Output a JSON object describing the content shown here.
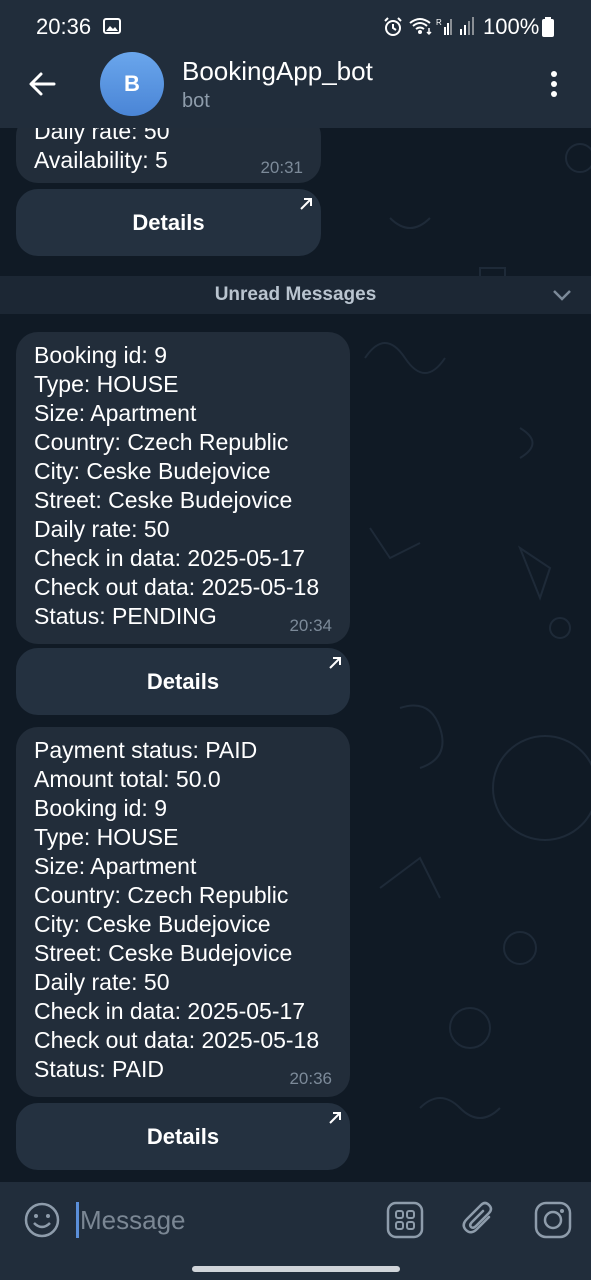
{
  "status_bar": {
    "time": "20:36",
    "battery": "100%"
  },
  "header": {
    "avatar_letter": "B",
    "title": "BookingApp_bot",
    "subtitle": "bot"
  },
  "messages": [
    {
      "lines": [
        "Daily rate: 50",
        "Availability: 5"
      ],
      "time": "20:31",
      "button": "Details"
    },
    {
      "lines": [
        "Booking id: 9",
        "Type: HOUSE",
        "Size: Apartment",
        "Country: Czech Republic",
        "City: Ceske Budejovice",
        "Street: Ceske Budejovice",
        "Daily rate: 50",
        "Check in data: 2025-05-17",
        "Check out data: 2025-05-18",
        "Status: PENDING"
      ],
      "time": "20:34",
      "button": "Details"
    },
    {
      "lines": [
        "Payment status: PAID",
        "Amount total: 50.0",
        "Booking id: 9",
        "Type: HOUSE",
        "Size: Apartment",
        "Country: Czech Republic",
        "City: Ceske Budejovice",
        "Street: Ceske Budejovice",
        "Daily rate: 50",
        "Check in data: 2025-05-17",
        "Check out data: 2025-05-18",
        "Status: PAID"
      ],
      "time": "20:36",
      "button": "Details"
    }
  ],
  "unread_label": "Unread Messages",
  "input": {
    "placeholder": "Message"
  },
  "colors": {
    "bubble": "#222d3a",
    "header": "#212d3b",
    "accent": "#5b8fd9",
    "avatar": "#5b96e3"
  },
  "icons": {
    "back": "arrow-left-icon",
    "more": "more-vertical-icon",
    "emoji": "smiley-icon",
    "bot_menu": "grid-menu-icon",
    "attach": "paperclip-icon",
    "camera": "camera-icon",
    "button_link": "arrow-up-right-icon"
  }
}
